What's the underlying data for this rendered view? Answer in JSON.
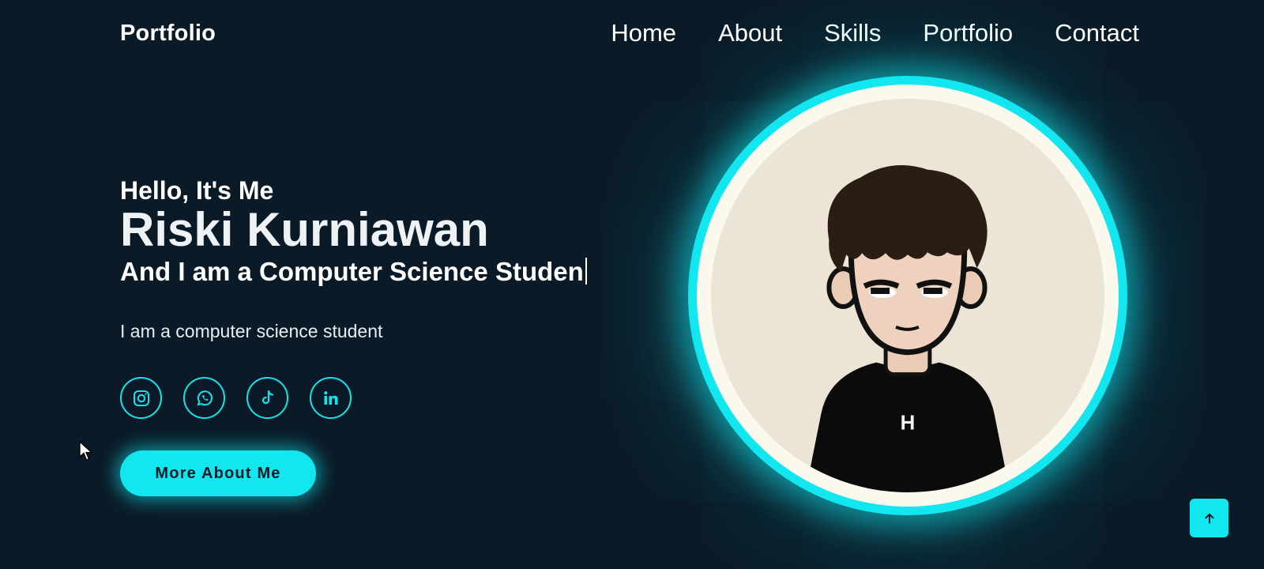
{
  "header": {
    "logo": "Portfolio",
    "nav": [
      "Home",
      "About",
      "Skills",
      "Portfolio",
      "Contact"
    ]
  },
  "hero": {
    "greeting": "Hello, It's Me",
    "name": "Riski Kurniawan",
    "role": "And I am a Computer Science Studen",
    "description": "I am a computer science student",
    "cta_label": "More About Me",
    "socials": [
      {
        "icon": "instagram-icon"
      },
      {
        "icon": "whatsapp-icon"
      },
      {
        "icon": "tiktok-icon"
      },
      {
        "icon": "linkedin-icon"
      }
    ]
  },
  "portrait": {
    "logo_text": "H"
  },
  "colors": {
    "background": "#0a1b27",
    "accent": "#12e6ef",
    "text": "#ffffff"
  },
  "icons": {
    "back_to_top": "arrow-up-icon",
    "cursor": "mouse-pointer-icon"
  }
}
